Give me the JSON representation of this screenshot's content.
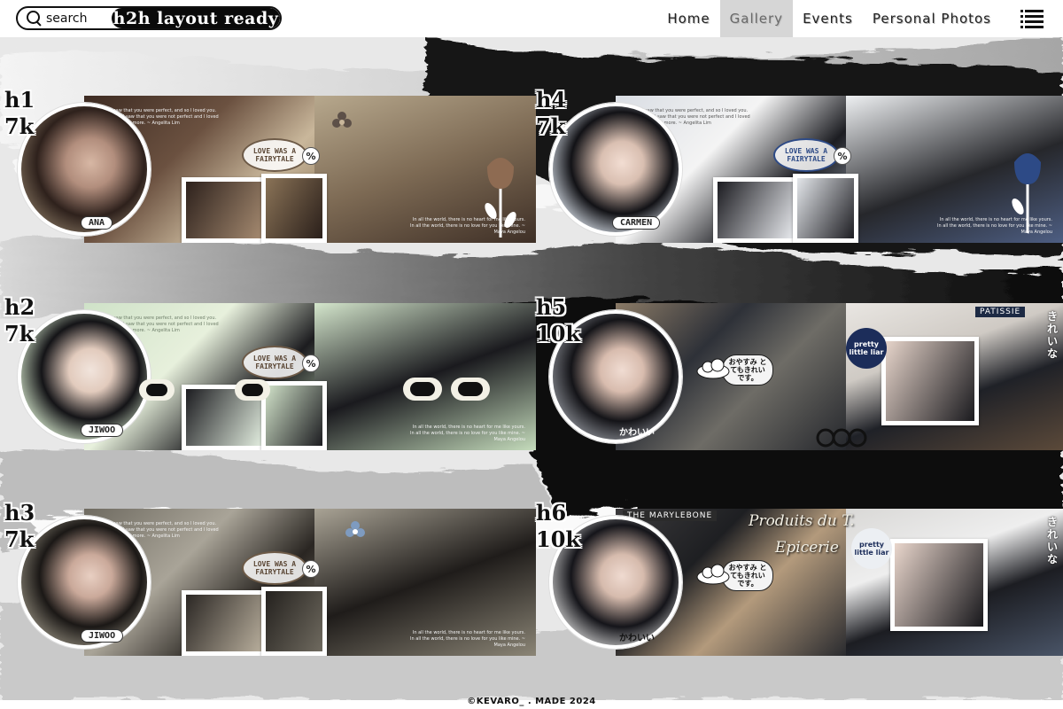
{
  "header": {
    "search_label": "search",
    "site_title": "h2h layout ready",
    "nav": [
      {
        "label": "Home",
        "active": false
      },
      {
        "label": "Gallery",
        "active": true
      },
      {
        "label": "Events",
        "active": false
      },
      {
        "label": "Personal Photos",
        "active": false
      }
    ],
    "menu_icon": "hamburger-menu-icon"
  },
  "cards": [
    {
      "id": "h1",
      "count": "7k",
      "name_tag": "ANA",
      "theme": "beige",
      "accent": "#8b7357"
    },
    {
      "id": "h2",
      "count": "7k",
      "name_tag": "JIWOO",
      "theme": "mint",
      "accent": "#7d9f7c"
    },
    {
      "id": "h3",
      "count": "7k",
      "name_tag": "JIWOO",
      "theme": "grey",
      "accent": "#6d6a62"
    },
    {
      "id": "h4",
      "count": "7k",
      "name_tag": "CARMEN",
      "theme": "blue",
      "accent": "#2d4a86"
    },
    {
      "id": "h5",
      "count": "10k",
      "name_tag": "かわいい",
      "theme": "street"
    },
    {
      "id": "h6",
      "count": "10k",
      "name_tag": "かわいい",
      "theme": "shop"
    }
  ],
  "banner_text": {
    "fairytale": "LOVE WAS A FAIRYTALE",
    "percent": "%",
    "quote_top": "I saw that you were perfect, and so I loved you. Then I saw that you were not perfect and I loved you even more. ~ Angelita Lim",
    "quote_bottom": "In all the world, there is no heart for me like yours. In all the world, there is no love for you like mine. ~ Maya Angelou",
    "sticker_jp": "おやすみ とてもきれい です。",
    "pretty": "pretty little liar",
    "vertical_jp": "きれいな",
    "patisserie": "PATISSIE",
    "marylebone": "THE MARYLEBONE",
    "produits": "Produits du T.",
    "epicerie": "Epicerie"
  },
  "footer": "©KEVARO_ . MADE 2024"
}
